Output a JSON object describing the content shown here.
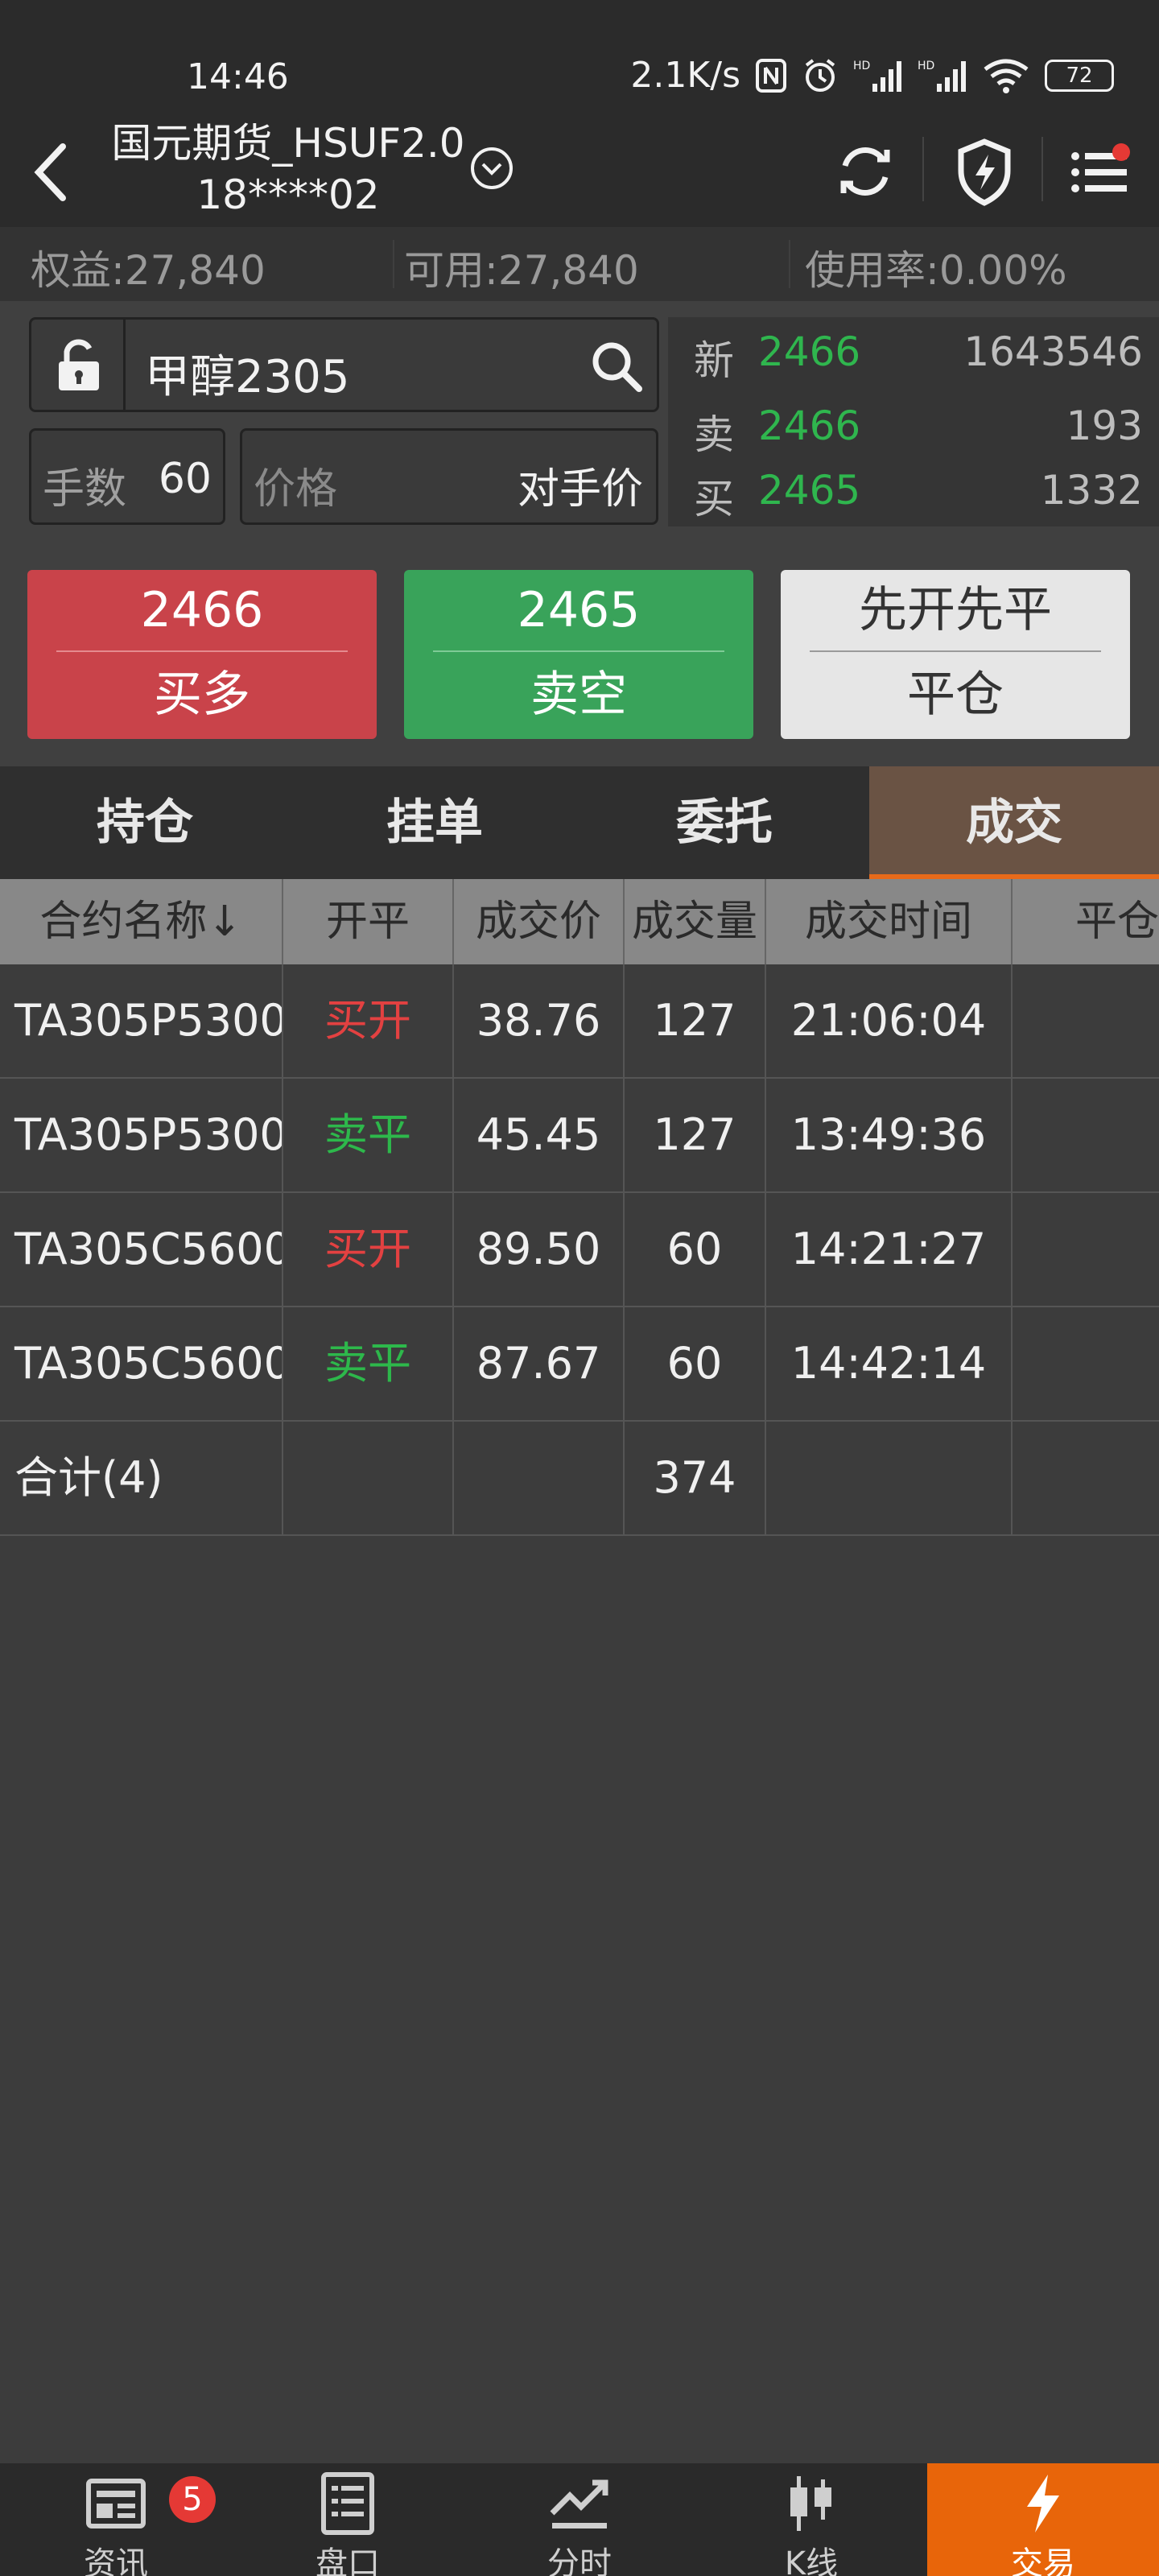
{
  "status_bar": {
    "time": "14:46",
    "network_speed": "2.1K/s",
    "battery": "72",
    "icons": [
      "nfc-icon",
      "alarm-icon",
      "signal-hd-icon",
      "signal-hd-icon",
      "wifi-icon",
      "battery-icon"
    ]
  },
  "header": {
    "account_line1": "国元期货_HSUF2.0",
    "account_line2": "18****02",
    "icons": [
      "back-icon",
      "chevron-down-icon",
      "refresh-icon",
      "shield-lightning-icon",
      "menu-list-icon"
    ],
    "notify_color": "#e53935"
  },
  "summary": {
    "equity": "权益:27,840",
    "available": "可用:27,840",
    "usage": "使用率:0.00%"
  },
  "order": {
    "symbol": "甲醇2305",
    "qty_label": "手数",
    "qty_value": "60",
    "price_label": "价格",
    "price_mode": "对手价"
  },
  "quote": {
    "rows": [
      {
        "label": "新",
        "price": "2466",
        "volume": "1643546"
      },
      {
        "label": "卖",
        "price": "2466",
        "volume": "193"
      },
      {
        "label": "买",
        "price": "2465",
        "volume": "1332"
      }
    ],
    "price_color": "#2fb64e"
  },
  "actions": {
    "buy": {
      "price": "2466",
      "label": "买多"
    },
    "sell": {
      "price": "2465",
      "label": "卖空"
    },
    "close": {
      "price": "先开先平",
      "label": "平仓"
    }
  },
  "tabs": [
    {
      "label": "持仓"
    },
    {
      "label": "挂单"
    },
    {
      "label": "委托"
    },
    {
      "label": "成交",
      "active": true
    }
  ],
  "table": {
    "headers": [
      "合约名称↓",
      "开平",
      "成交价",
      "成交量",
      "成交时间",
      "平仓"
    ],
    "rows": [
      [
        "TA305P5300",
        "买开",
        "38.76",
        "127",
        "21:06:04",
        ""
      ],
      [
        "TA305P5300",
        "卖平",
        "45.45",
        "127",
        "13:49:36",
        ""
      ],
      [
        "TA305C5600",
        "买开",
        "89.50",
        "60",
        "14:21:27",
        ""
      ],
      [
        "TA305C5600",
        "卖平",
        "87.67",
        "60",
        "14:42:14",
        ""
      ]
    ],
    "total": [
      "合计(4)",
      "",
      "",
      "374",
      "",
      ""
    ]
  },
  "bottom_nav": [
    {
      "label": "资讯",
      "icon": "news-icon",
      "badge": "5"
    },
    {
      "label": "盘口",
      "icon": "orderbook-icon"
    },
    {
      "label": "分时",
      "icon": "timeshare-chart-icon"
    },
    {
      "label": "K线",
      "icon": "candlestick-icon"
    },
    {
      "label": "交易",
      "icon": "lightning-icon",
      "active": true
    }
  ],
  "colors": {
    "buy": "#c9434a",
    "sell": "#39a35a",
    "accent": "#e8650a"
  }
}
